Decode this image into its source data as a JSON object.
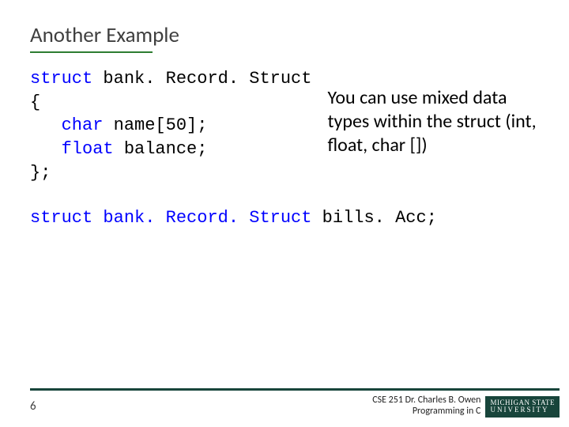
{
  "title": "Another Example",
  "code": {
    "kw_struct": "struct",
    "type_name": " bank. Record. Struct",
    "open": "{",
    "line1_kw": "char",
    "line1_rest": " name[50];",
    "line2_kw": "float",
    "line2_rest": " balance;",
    "close": "};"
  },
  "explain": "You can use mixed data types within the struct (int, float, char [])",
  "decl": {
    "kw": "struct",
    "type": " bank. Record. Struct",
    "var": " bills. Acc;"
  },
  "footer": {
    "page": "6",
    "line1": "CSE 251 Dr. Charles B. Owen",
    "line2": "Programming in C",
    "logo_top": "MICHIGAN STATE",
    "logo_bot": "UNIVERSITY"
  }
}
